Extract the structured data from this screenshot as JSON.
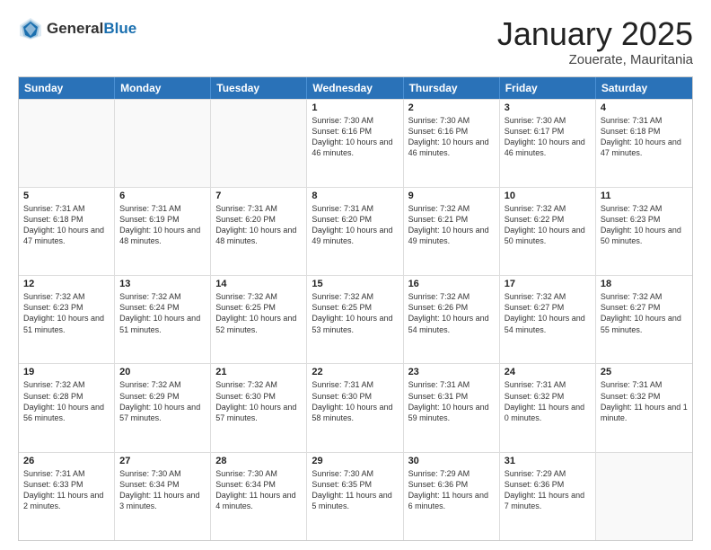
{
  "header": {
    "logo_general": "General",
    "logo_blue": "Blue",
    "title": "January 2025",
    "subtitle": "Zouerate, Mauritania"
  },
  "days_of_week": [
    "Sunday",
    "Monday",
    "Tuesday",
    "Wednesday",
    "Thursday",
    "Friday",
    "Saturday"
  ],
  "weeks": [
    [
      {
        "day": "",
        "empty": true
      },
      {
        "day": "",
        "empty": true
      },
      {
        "day": "",
        "empty": true
      },
      {
        "day": "1",
        "sunrise": "Sunrise: 7:30 AM",
        "sunset": "Sunset: 6:16 PM",
        "daylight": "Daylight: 10 hours and 46 minutes."
      },
      {
        "day": "2",
        "sunrise": "Sunrise: 7:30 AM",
        "sunset": "Sunset: 6:16 PM",
        "daylight": "Daylight: 10 hours and 46 minutes."
      },
      {
        "day": "3",
        "sunrise": "Sunrise: 7:30 AM",
        "sunset": "Sunset: 6:17 PM",
        "daylight": "Daylight: 10 hours and 46 minutes."
      },
      {
        "day": "4",
        "sunrise": "Sunrise: 7:31 AM",
        "sunset": "Sunset: 6:18 PM",
        "daylight": "Daylight: 10 hours and 47 minutes."
      }
    ],
    [
      {
        "day": "5",
        "sunrise": "Sunrise: 7:31 AM",
        "sunset": "Sunset: 6:18 PM",
        "daylight": "Daylight: 10 hours and 47 minutes."
      },
      {
        "day": "6",
        "sunrise": "Sunrise: 7:31 AM",
        "sunset": "Sunset: 6:19 PM",
        "daylight": "Daylight: 10 hours and 48 minutes."
      },
      {
        "day": "7",
        "sunrise": "Sunrise: 7:31 AM",
        "sunset": "Sunset: 6:20 PM",
        "daylight": "Daylight: 10 hours and 48 minutes."
      },
      {
        "day": "8",
        "sunrise": "Sunrise: 7:31 AM",
        "sunset": "Sunset: 6:20 PM",
        "daylight": "Daylight: 10 hours and 49 minutes."
      },
      {
        "day": "9",
        "sunrise": "Sunrise: 7:32 AM",
        "sunset": "Sunset: 6:21 PM",
        "daylight": "Daylight: 10 hours and 49 minutes."
      },
      {
        "day": "10",
        "sunrise": "Sunrise: 7:32 AM",
        "sunset": "Sunset: 6:22 PM",
        "daylight": "Daylight: 10 hours and 50 minutes."
      },
      {
        "day": "11",
        "sunrise": "Sunrise: 7:32 AM",
        "sunset": "Sunset: 6:23 PM",
        "daylight": "Daylight: 10 hours and 50 minutes."
      }
    ],
    [
      {
        "day": "12",
        "sunrise": "Sunrise: 7:32 AM",
        "sunset": "Sunset: 6:23 PM",
        "daylight": "Daylight: 10 hours and 51 minutes."
      },
      {
        "day": "13",
        "sunrise": "Sunrise: 7:32 AM",
        "sunset": "Sunset: 6:24 PM",
        "daylight": "Daylight: 10 hours and 51 minutes."
      },
      {
        "day": "14",
        "sunrise": "Sunrise: 7:32 AM",
        "sunset": "Sunset: 6:25 PM",
        "daylight": "Daylight: 10 hours and 52 minutes."
      },
      {
        "day": "15",
        "sunrise": "Sunrise: 7:32 AM",
        "sunset": "Sunset: 6:25 PM",
        "daylight": "Daylight: 10 hours and 53 minutes."
      },
      {
        "day": "16",
        "sunrise": "Sunrise: 7:32 AM",
        "sunset": "Sunset: 6:26 PM",
        "daylight": "Daylight: 10 hours and 54 minutes."
      },
      {
        "day": "17",
        "sunrise": "Sunrise: 7:32 AM",
        "sunset": "Sunset: 6:27 PM",
        "daylight": "Daylight: 10 hours and 54 minutes."
      },
      {
        "day": "18",
        "sunrise": "Sunrise: 7:32 AM",
        "sunset": "Sunset: 6:27 PM",
        "daylight": "Daylight: 10 hours and 55 minutes."
      }
    ],
    [
      {
        "day": "19",
        "sunrise": "Sunrise: 7:32 AM",
        "sunset": "Sunset: 6:28 PM",
        "daylight": "Daylight: 10 hours and 56 minutes."
      },
      {
        "day": "20",
        "sunrise": "Sunrise: 7:32 AM",
        "sunset": "Sunset: 6:29 PM",
        "daylight": "Daylight: 10 hours and 57 minutes."
      },
      {
        "day": "21",
        "sunrise": "Sunrise: 7:32 AM",
        "sunset": "Sunset: 6:30 PM",
        "daylight": "Daylight: 10 hours and 57 minutes."
      },
      {
        "day": "22",
        "sunrise": "Sunrise: 7:31 AM",
        "sunset": "Sunset: 6:30 PM",
        "daylight": "Daylight: 10 hours and 58 minutes."
      },
      {
        "day": "23",
        "sunrise": "Sunrise: 7:31 AM",
        "sunset": "Sunset: 6:31 PM",
        "daylight": "Daylight: 10 hours and 59 minutes."
      },
      {
        "day": "24",
        "sunrise": "Sunrise: 7:31 AM",
        "sunset": "Sunset: 6:32 PM",
        "daylight": "Daylight: 11 hours and 0 minutes."
      },
      {
        "day": "25",
        "sunrise": "Sunrise: 7:31 AM",
        "sunset": "Sunset: 6:32 PM",
        "daylight": "Daylight: 11 hours and 1 minute."
      }
    ],
    [
      {
        "day": "26",
        "sunrise": "Sunrise: 7:31 AM",
        "sunset": "Sunset: 6:33 PM",
        "daylight": "Daylight: 11 hours and 2 minutes."
      },
      {
        "day": "27",
        "sunrise": "Sunrise: 7:30 AM",
        "sunset": "Sunset: 6:34 PM",
        "daylight": "Daylight: 11 hours and 3 minutes."
      },
      {
        "day": "28",
        "sunrise": "Sunrise: 7:30 AM",
        "sunset": "Sunset: 6:34 PM",
        "daylight": "Daylight: 11 hours and 4 minutes."
      },
      {
        "day": "29",
        "sunrise": "Sunrise: 7:30 AM",
        "sunset": "Sunset: 6:35 PM",
        "daylight": "Daylight: 11 hours and 5 minutes."
      },
      {
        "day": "30",
        "sunrise": "Sunrise: 7:29 AM",
        "sunset": "Sunset: 6:36 PM",
        "daylight": "Daylight: 11 hours and 6 minutes."
      },
      {
        "day": "31",
        "sunrise": "Sunrise: 7:29 AM",
        "sunset": "Sunset: 6:36 PM",
        "daylight": "Daylight: 11 hours and 7 minutes."
      },
      {
        "day": "",
        "empty": true
      }
    ]
  ]
}
